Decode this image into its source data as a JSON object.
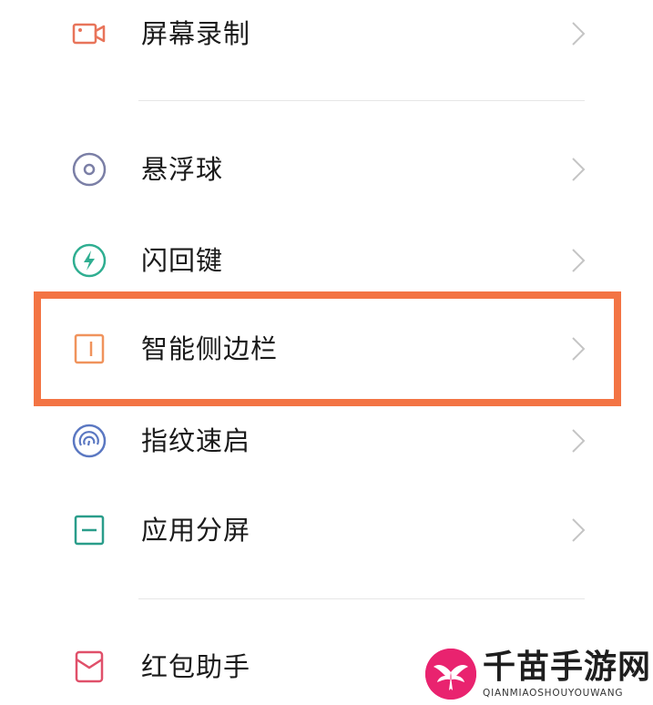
{
  "settings": {
    "items": [
      {
        "label": "屏幕录制",
        "icon": "video-record-icon",
        "color": "#e8745a"
      },
      {
        "label": "悬浮球",
        "icon": "floating-ball-icon",
        "color": "#7b7fa6"
      },
      {
        "label": "闪回键",
        "icon": "flash-back-icon",
        "color": "#2fae91"
      },
      {
        "label": "智能侧边栏",
        "icon": "smart-sidebar-icon",
        "color": "#f0935c"
      },
      {
        "label": "指纹速启",
        "icon": "fingerprint-icon",
        "color": "#5b78c2"
      },
      {
        "label": "应用分屏",
        "icon": "split-screen-icon",
        "color": "#2a9d8a"
      },
      {
        "label": "红包助手",
        "icon": "red-packet-icon",
        "color": "#e0506a"
      }
    ],
    "highlight_color": "#f37444"
  },
  "watermark": {
    "title": "千苗手游网",
    "subtitle": "QIANMIAOSHOUYOUWANG",
    "logo_color": "#e9236f"
  }
}
